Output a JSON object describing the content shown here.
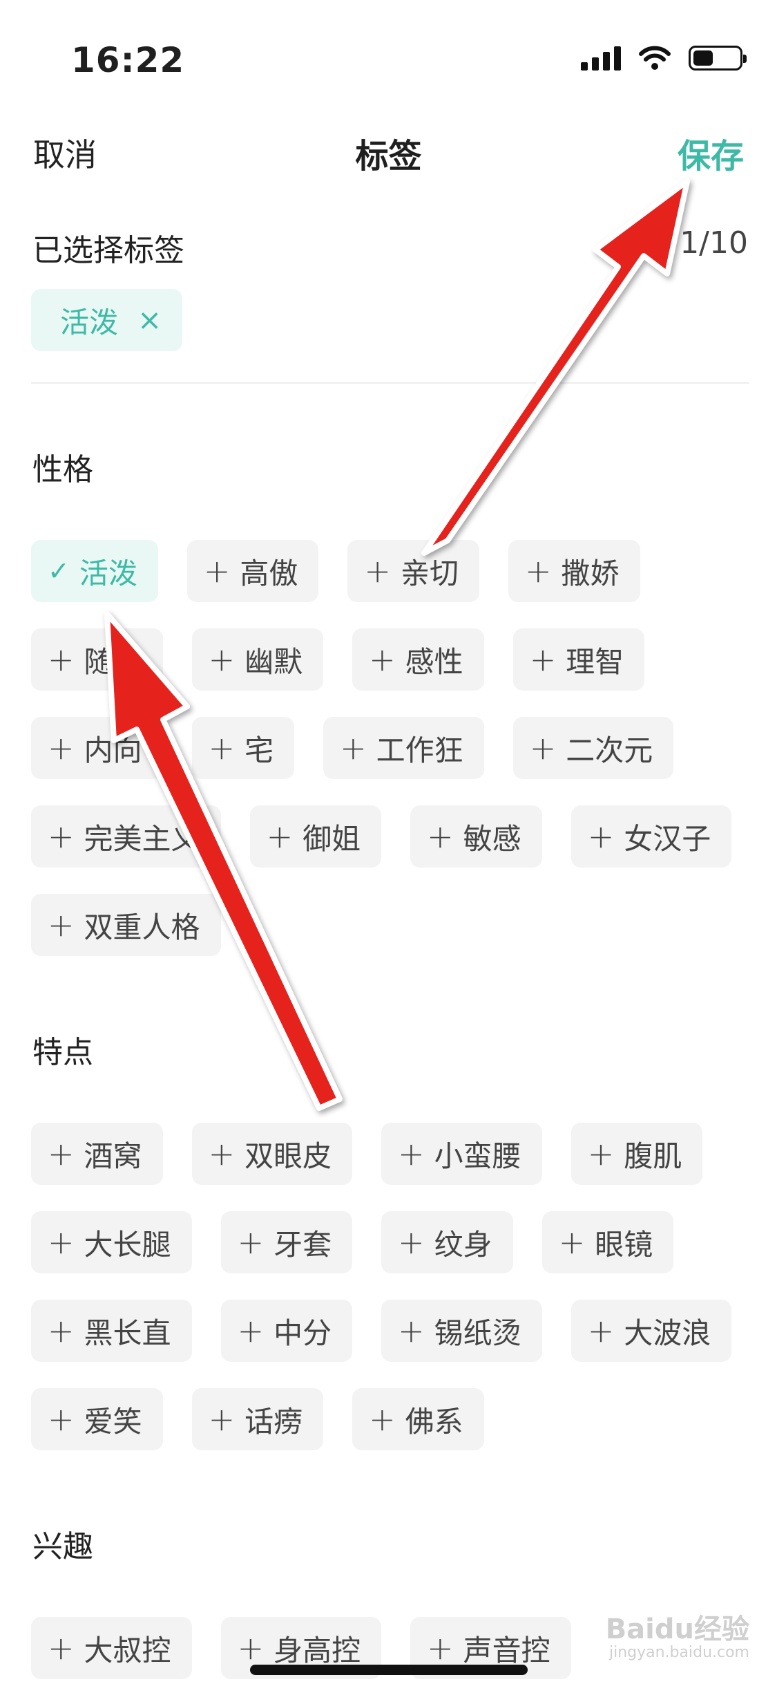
{
  "status_bar": {
    "time": "16:22"
  },
  "nav": {
    "cancel": "取消",
    "title": "标签",
    "save": "保存"
  },
  "selected": {
    "title": "已选择标签",
    "count": "1/10",
    "chips": [
      {
        "label": "活泼",
        "remove": "×"
      }
    ]
  },
  "sections": [
    {
      "title": "性格",
      "tags": [
        {
          "label": "活泼",
          "selected": true
        },
        {
          "label": "高傲"
        },
        {
          "label": "亲切"
        },
        {
          "label": "撒娇"
        },
        {
          "label": "随和"
        },
        {
          "label": "幽默"
        },
        {
          "label": "感性"
        },
        {
          "label": "理智"
        },
        {
          "label": "内向"
        },
        {
          "label": "宅"
        },
        {
          "label": "工作狂"
        },
        {
          "label": "二次元"
        },
        {
          "label": "完美主义"
        },
        {
          "label": "御姐"
        },
        {
          "label": "敏感"
        },
        {
          "label": "女汉子"
        },
        {
          "label": "双重人格"
        }
      ]
    },
    {
      "title": "特点",
      "tags": [
        {
          "label": "酒窝"
        },
        {
          "label": "双眼皮"
        },
        {
          "label": "小蛮腰"
        },
        {
          "label": "腹肌"
        },
        {
          "label": "大长腿"
        },
        {
          "label": "牙套"
        },
        {
          "label": "纹身"
        },
        {
          "label": "眼镜"
        },
        {
          "label": "黑长直"
        },
        {
          "label": "中分"
        },
        {
          "label": "锡纸烫"
        },
        {
          "label": "大波浪"
        },
        {
          "label": "爱笑"
        },
        {
          "label": "话痨"
        },
        {
          "label": "佛系"
        }
      ]
    },
    {
      "title": "兴趣",
      "tags": [
        {
          "label": "大叔控"
        },
        {
          "label": "身高控"
        },
        {
          "label": "声音控"
        }
      ]
    }
  ],
  "icons": {
    "add": "plus-icon",
    "check": "check-icon",
    "remove": "close-icon"
  },
  "colors": {
    "accent": "#3dbaa5",
    "chip_bg": "#f3f3f3",
    "selected_bg": "#e9f7f5",
    "arrow": "#e5201f"
  },
  "watermark": {
    "brand": "Baidu经验",
    "url": "jingyan.baidu.com"
  }
}
